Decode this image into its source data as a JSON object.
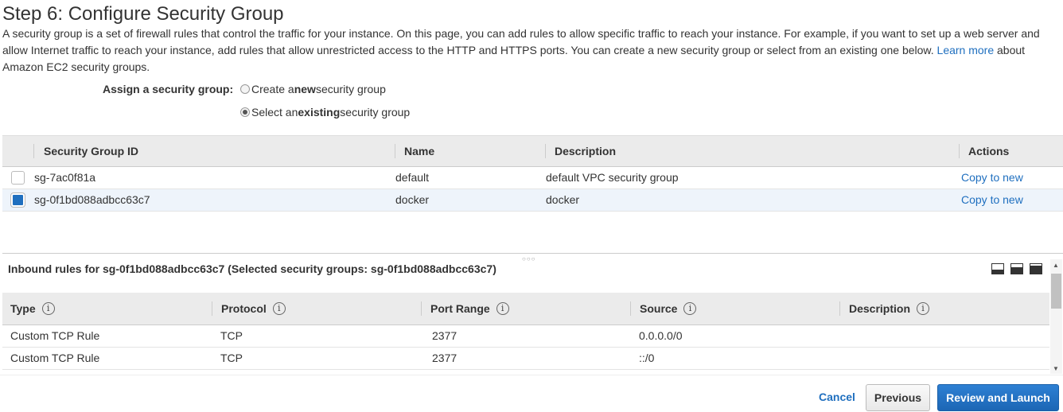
{
  "page": {
    "title": "Step 6: Configure Security Group",
    "intro_1": "A security group is a set of firewall rules that control the traffic for your instance. On this page, you can add rules to allow specific traffic to reach your instance. For example, if you want to set up a web server and allow Internet traffic to reach your instance, add rules that allow unrestricted access to the HTTP and HTTPS ports. You can create a new security group or select from an existing one below. ",
    "learn_more": "Learn more",
    "intro_2": " about Amazon EC2 security groups."
  },
  "assign": {
    "label": "Assign a security group:",
    "options": [
      {
        "pre": "Create a ",
        "bold": "new",
        "post": " security group",
        "checked": false
      },
      {
        "pre": "Select an ",
        "bold": "existing",
        "post": " security group",
        "checked": true
      }
    ]
  },
  "sg_table": {
    "headers": {
      "id": "Security Group ID",
      "name": "Name",
      "description": "Description",
      "actions": "Actions"
    },
    "rows": [
      {
        "id": "sg-7ac0f81a",
        "name": "default",
        "description": "default VPC security group",
        "action": "Copy to new",
        "selected": false
      },
      {
        "id": "sg-0f1bd088adbcc63c7",
        "name": "docker",
        "description": "docker",
        "action": "Copy to new",
        "selected": true
      }
    ]
  },
  "inbound": {
    "title": "Inbound rules for sg-0f1bd088adbcc63c7 (Selected security groups: sg-0f1bd088adbcc63c7)",
    "headers": {
      "type": "Type",
      "protocol": "Protocol",
      "port_range": "Port Range",
      "source": "Source",
      "description": "Description"
    },
    "info_glyph": "i",
    "rows": [
      {
        "type": "Custom TCP Rule",
        "protocol": "TCP",
        "port_range": "2377",
        "source": "0.0.0.0/0",
        "description": ""
      },
      {
        "type": "Custom TCP Rule",
        "protocol": "TCP",
        "port_range": "2377",
        "source": "::/0",
        "description": ""
      }
    ]
  },
  "footer": {
    "cancel": "Cancel",
    "previous": "Previous",
    "review": "Review and Launch"
  },
  "colors": {
    "accent": "#1f6fbf",
    "selected_row": "#eef4fb",
    "header_bg": "#ebebeb"
  }
}
